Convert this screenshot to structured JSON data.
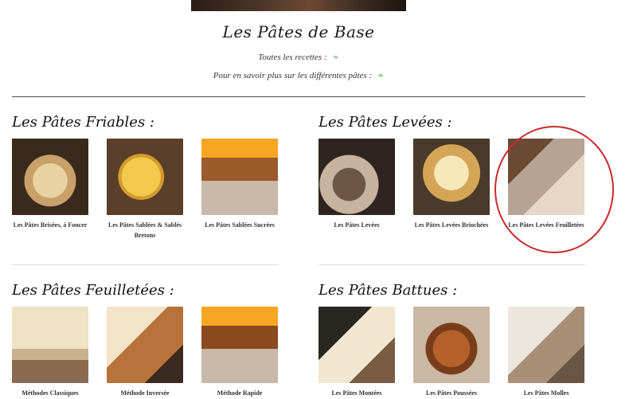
{
  "page": {
    "title": "Les Pâtes de Base",
    "links": [
      {
        "text": "Toutes les recettes :",
        "icon": "leaf-icon"
      },
      {
        "text": "Pour en savoir plus sur les différentes pâtes :",
        "icon": "leaf-icon"
      }
    ],
    "leaf_glyph": "❧"
  },
  "sections": {
    "friables": {
      "title": "Les Pâtes Friables :",
      "items": [
        {
          "caption": "Les Pâtes Brisées, à Foncer"
        },
        {
          "caption": "Les Pâtes Sablées & Sablés Bretons"
        },
        {
          "caption": "Les Pâtes Sablées Sucrées"
        }
      ]
    },
    "levees": {
      "title": "Les Pâtes Levées :",
      "items": [
        {
          "caption": "Les Pâtes Levées"
        },
        {
          "caption": "Les Pâtes Levées Briochées"
        },
        {
          "caption": "Les Pâtes Levées Feuilletées"
        }
      ]
    },
    "feuilletees": {
      "title": "Les Pâtes Feuilletées :",
      "items": [
        {
          "caption": "Méthodes Classiques"
        },
        {
          "caption": "Méthode Inversée"
        },
        {
          "caption": "Méthode Rapide"
        }
      ]
    },
    "battues": {
      "title": "Les Pâtes Battues :",
      "items": [
        {
          "caption": "Les Pâtes Montées"
        },
        {
          "caption": "Les Pâtes Poussées"
        },
        {
          "caption": "Les Pâtes Molles"
        }
      ]
    }
  },
  "colors": {
    "highlight_circle": "#c92a2a",
    "leaf": "#7bc97b"
  }
}
